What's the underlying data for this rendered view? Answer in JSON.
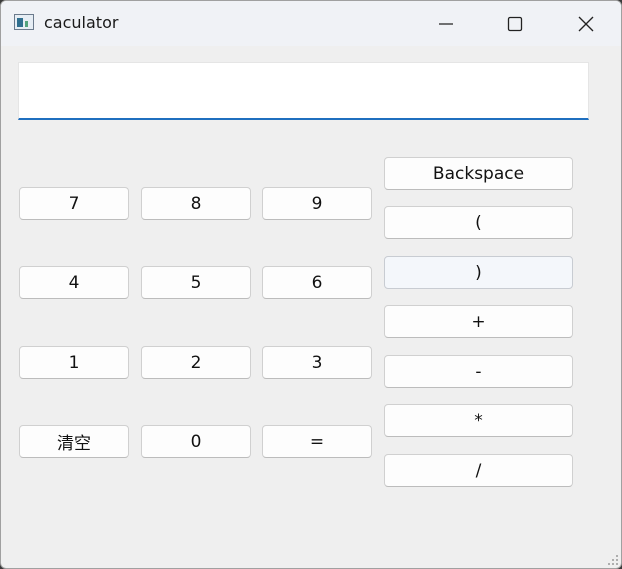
{
  "window": {
    "title": "caculator",
    "minimize_icon": "minimize-icon",
    "maximize_icon": "maximize-icon",
    "close_icon": "close-icon"
  },
  "display": {
    "value": "",
    "placeholder": ""
  },
  "keypad": {
    "k7": "7",
    "k8": "8",
    "k9": "9",
    "k4": "4",
    "k5": "5",
    "k6": "6",
    "k1": "1",
    "k2": "2",
    "k3": "3",
    "clear": "清空",
    "k0": "0",
    "equals": "="
  },
  "operators": {
    "backspace": "Backspace",
    "lparen": "(",
    "rparen": ")",
    "plus": "+",
    "minus": "-",
    "multiply": "*",
    "divide": "/"
  },
  "colors": {
    "accent": "#1f6fbf",
    "background": "#efefef"
  }
}
